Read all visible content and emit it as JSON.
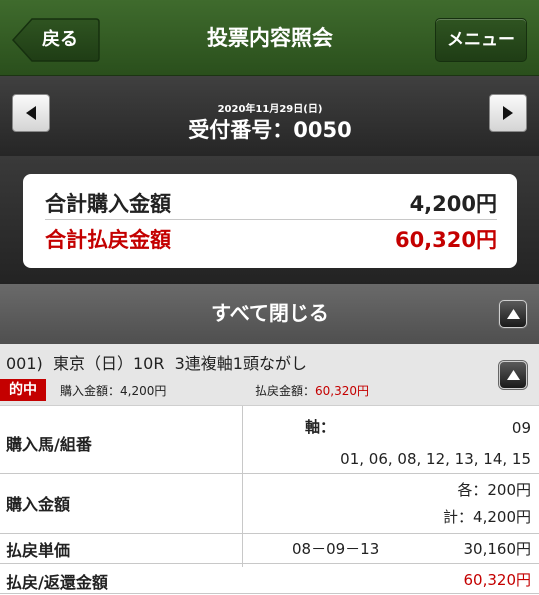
{
  "header": {
    "back_label": "戻る",
    "title": "投票内容照会",
    "menu_label": "メニュー"
  },
  "receipt": {
    "date": "2020年11月29日(日)",
    "number": "受付番号：0050"
  },
  "totals": {
    "purchase_label": "合計購入金額",
    "purchase_value": "4,200円",
    "payout_label": "合計払戻金額",
    "payout_value": "60,320円"
  },
  "close_all_label": "すべて閉じる",
  "bet": {
    "title": "001)  東京（日）10R  3連複軸1頭ながし",
    "hit_label": "的中",
    "purchase_text": "購入金額：4,200円",
    "payout_label": "払戻金額：",
    "payout_value": "60,320円"
  },
  "detail": {
    "horse_label": "購入馬/組番",
    "axis_label": "軸：",
    "axis_value": "09",
    "partners": "01, 06, 08, 12, 13, 14, 15",
    "amount_label": "購入金額",
    "each_amount": "各：200円",
    "total_amount": "計：4,200円",
    "unit_label": "払戻単価",
    "combo": "08－09－13",
    "unit_value": "30,160円",
    "refund_label": "払戻/返還金額",
    "refund_value": "60,320円"
  },
  "colors": {
    "header_green": "#2f5a22",
    "accent_red": "#c40000",
    "dark_bar": "#2e2e2e",
    "close_bar": "#5c5c5c"
  },
  "icons": {
    "back": "back-arrow-icon",
    "prev": "triangle-left-icon",
    "next": "triangle-right-icon",
    "collapse": "triangle-up-icon"
  }
}
